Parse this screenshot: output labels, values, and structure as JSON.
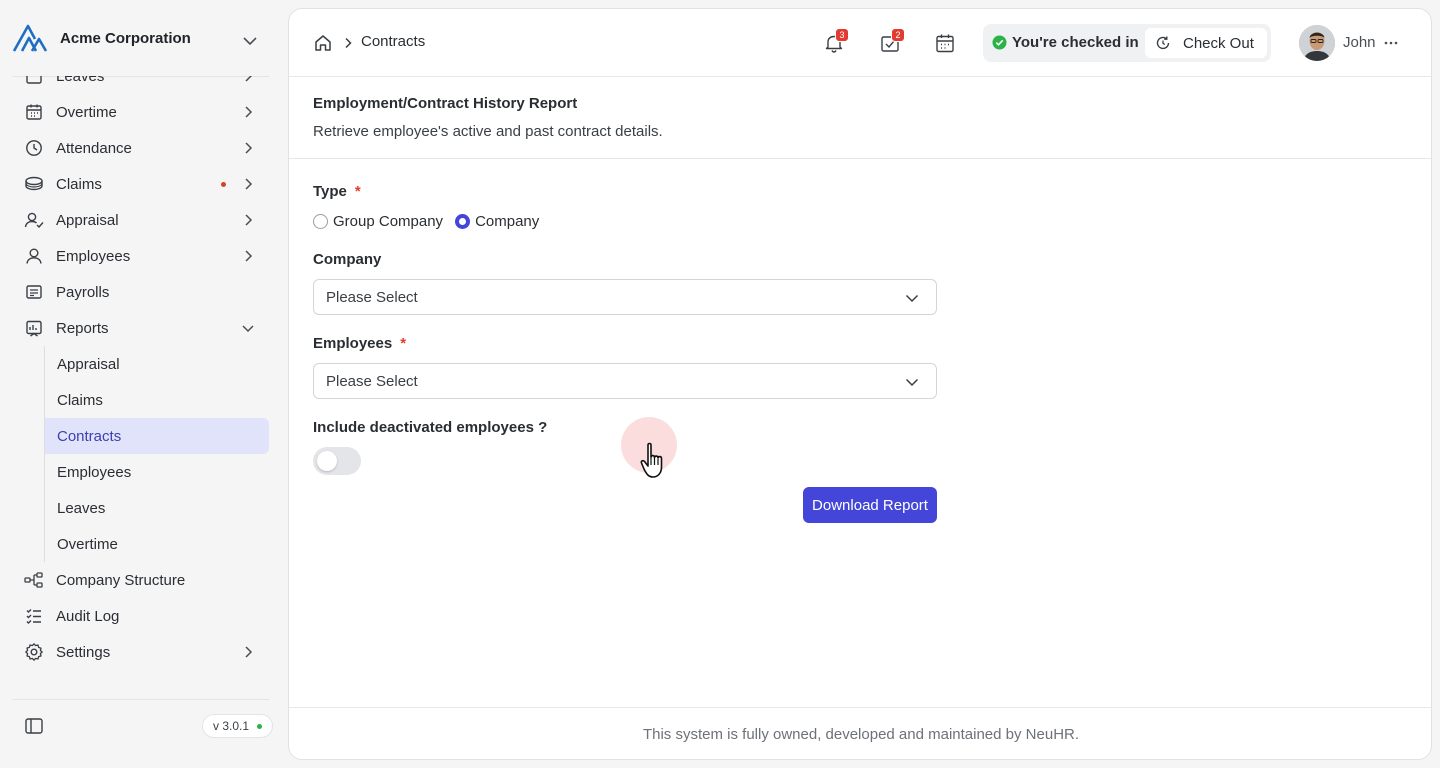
{
  "org": {
    "name": "Acme Corporation"
  },
  "sidebar": {
    "items": [
      {
        "label": "Leaves",
        "icon": "calendar-icon",
        "chevron": true
      },
      {
        "label": "Overtime",
        "icon": "calendar-clock-icon",
        "chevron": true
      },
      {
        "label": "Attendance",
        "icon": "clock-icon",
        "chevron": true
      },
      {
        "label": "Claims",
        "icon": "coins-icon",
        "chevron": true,
        "dot": true
      },
      {
        "label": "Appraisal",
        "icon": "user-check-icon",
        "chevron": true
      },
      {
        "label": "Employees",
        "icon": "user-icon",
        "chevron": true
      },
      {
        "label": "Payrolls",
        "icon": "receipt-icon",
        "chevron": false
      },
      {
        "label": "Reports",
        "icon": "report-icon",
        "chevron": true,
        "expanded": true
      }
    ],
    "report_subitems": [
      {
        "label": "Appraisal",
        "active": false
      },
      {
        "label": "Claims",
        "active": false
      },
      {
        "label": "Contracts",
        "active": true
      },
      {
        "label": "Employees",
        "active": false
      },
      {
        "label": "Leaves",
        "active": false
      },
      {
        "label": "Overtime",
        "active": false
      }
    ],
    "after_items": [
      {
        "label": "Company Structure",
        "icon": "org-chart-icon",
        "chevron": false
      },
      {
        "label": "Audit Log",
        "icon": "checklist-icon",
        "chevron": false
      },
      {
        "label": "Settings",
        "icon": "gear-icon",
        "chevron": true
      }
    ],
    "version": "v 3.0.1"
  },
  "header": {
    "breadcrumb_current": "Contracts",
    "notifications_count": "3",
    "tasks_count": "2",
    "checkin_status": "You're checked in",
    "checkout_label": "Check Out",
    "user_name": "John"
  },
  "report": {
    "title": "Employment/Contract History Report",
    "subtitle": "Retrieve employee's active and past contract details."
  },
  "form": {
    "type_label": "Type",
    "required_mark": "*",
    "type_options": [
      {
        "label": "Group Company",
        "selected": false
      },
      {
        "label": "Company",
        "selected": true
      }
    ],
    "company_label": "Company",
    "company_placeholder": "Please Select",
    "employees_label": "Employees",
    "employees_placeholder": "Please Select",
    "deactivated_label": "Include deactivated employees ?",
    "deactivated_on": false,
    "download_label": "Download Report"
  },
  "footer": {
    "text": "This system is fully owned, developed and maintained by NeuHR."
  },
  "colors": {
    "accent": "#4346d8",
    "active_bg": "#e1e3fa",
    "badge": "#e23b2f",
    "success": "#2bb34a"
  }
}
